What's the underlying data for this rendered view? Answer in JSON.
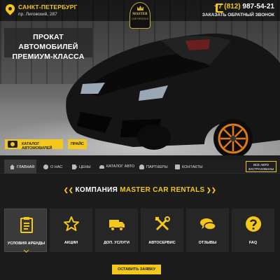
{
  "header": {
    "city": "САНКТ-ПЕТЕРБУРГ",
    "address": "пр. Лиговский, 287",
    "logo_text": "MASTER",
    "logo_sub": "CAR RENTALS",
    "phone_prefix": "+7 (812) ",
    "phone_main": "987-54-21",
    "callback": "ЗАКАЗАТЬ ОБРАТНЫЙ ЗВОНОК"
  },
  "hero": {
    "banner_line1": "ПРОКАТ АВТОМОБИЛЕЙ",
    "banner_line2": "ПРЕМИУМ-КЛАССА",
    "catalog_button": "КАТАЛОГ АВТОМОБИЛЕЙ",
    "price_button": "ПРАЙС"
  },
  "nav": {
    "items": [
      {
        "label": "ГЛАВНАЯ",
        "icon": "home-icon",
        "active": true
      },
      {
        "label": "О НАС",
        "icon": "info-icon"
      },
      {
        "label": "ЦЕНЫ",
        "icon": "price-tag-icon"
      },
      {
        "label": "КАТАЛОГ АВТО",
        "icon": "car-icon"
      },
      {
        "label": "ПАРТНЕРЫ",
        "icon": "partners-icon"
      },
      {
        "label": "КОНТАКТЫ",
        "icon": "phone-icon"
      }
    ],
    "all_cars_line1": "ВСЕ АВТО",
    "all_cars_line2": "ЗАСТРАХОВАНЫ"
  },
  "section": {
    "title_prefix": "КОМПАНИЯ ",
    "title_accent": "MASTER CAR RENTALS"
  },
  "services": [
    {
      "label": "УСЛОВИЯ АРЕНДЫ",
      "icon": "clipboard-icon",
      "active": true
    },
    {
      "label": "АКЦИИ",
      "icon": "star-icon"
    },
    {
      "label": "ДОП. УСЛУГИ",
      "icon": "truck-icon"
    },
    {
      "label": "АВТОСЕРВИС",
      "icon": "tools-icon"
    },
    {
      "label": "ОТЗЫВЫ",
      "icon": "chat-icon"
    },
    {
      "label": "FAQ",
      "icon": "question-icon"
    }
  ],
  "order_button": "ОСТАВИТЬ ЗАЯВКУ",
  "colors": {
    "accent": "#f3c71b",
    "background": "#1c1c1c",
    "tile": "#262626"
  }
}
